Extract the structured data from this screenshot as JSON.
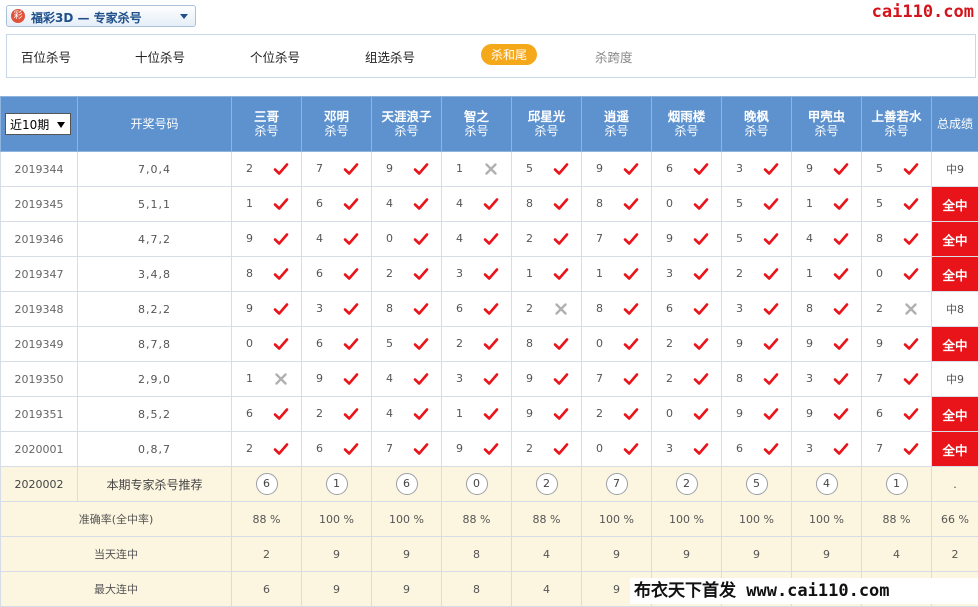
{
  "selector": {
    "icon_char": "彩",
    "label": "福彩3D — 专家杀号"
  },
  "site_logo": "cai110.com",
  "tabs": [
    {
      "label": "百位杀号",
      "state": "normal"
    },
    {
      "label": "十位杀号",
      "state": "normal"
    },
    {
      "label": "个位杀号",
      "state": "normal"
    },
    {
      "label": "组选杀号",
      "state": "normal"
    },
    {
      "label": "杀和尾",
      "state": "active"
    },
    {
      "label": "杀跨度",
      "state": "dim"
    }
  ],
  "table": {
    "period_select": "近10期",
    "draw_header": "开奖号码",
    "result_header": "总成绩",
    "sub_label": "杀号",
    "experts": [
      "三哥",
      "邓明",
      "天涯浪子",
      "智之",
      "邱星光",
      "逍遥",
      "烟雨楼",
      "晚枫",
      "甲壳虫",
      "上善若水"
    ],
    "rows": [
      {
        "issue": "2019344",
        "draw": "7,0,4",
        "kills": [
          2,
          7,
          9,
          1,
          5,
          9,
          6,
          3,
          9,
          5
        ],
        "hits": [
          1,
          1,
          1,
          0,
          1,
          1,
          1,
          1,
          1,
          1
        ],
        "result": "中9",
        "all": false
      },
      {
        "issue": "2019345",
        "draw": "5,1,1",
        "kills": [
          1,
          6,
          4,
          4,
          8,
          8,
          0,
          5,
          1,
          5
        ],
        "hits": [
          1,
          1,
          1,
          1,
          1,
          1,
          1,
          1,
          1,
          1
        ],
        "result": "全中",
        "all": true
      },
      {
        "issue": "2019346",
        "draw": "4,7,2",
        "kills": [
          9,
          4,
          0,
          4,
          2,
          7,
          9,
          5,
          4,
          8
        ],
        "hits": [
          1,
          1,
          1,
          1,
          1,
          1,
          1,
          1,
          1,
          1
        ],
        "result": "全中",
        "all": true
      },
      {
        "issue": "2019347",
        "draw": "3,4,8",
        "kills": [
          8,
          6,
          2,
          3,
          1,
          1,
          3,
          2,
          1,
          0
        ],
        "hits": [
          1,
          1,
          1,
          1,
          1,
          1,
          1,
          1,
          1,
          1
        ],
        "result": "全中",
        "all": true
      },
      {
        "issue": "2019348",
        "draw": "8,2,2",
        "kills": [
          9,
          3,
          8,
          6,
          2,
          8,
          6,
          3,
          8,
          2
        ],
        "hits": [
          1,
          1,
          1,
          1,
          0,
          1,
          1,
          1,
          1,
          0
        ],
        "result": "中8",
        "all": false
      },
      {
        "issue": "2019349",
        "draw": "8,7,8",
        "kills": [
          0,
          6,
          5,
          2,
          8,
          0,
          2,
          9,
          9,
          9
        ],
        "hits": [
          1,
          1,
          1,
          1,
          1,
          1,
          1,
          1,
          1,
          1
        ],
        "result": "全中",
        "all": true
      },
      {
        "issue": "2019350",
        "draw": "2,9,0",
        "kills": [
          1,
          9,
          4,
          3,
          9,
          7,
          2,
          8,
          3,
          7
        ],
        "hits": [
          0,
          1,
          1,
          1,
          1,
          1,
          1,
          1,
          1,
          1
        ],
        "result": "中9",
        "all": false
      },
      {
        "issue": "2019351",
        "draw": "8,5,2",
        "kills": [
          6,
          2,
          4,
          1,
          9,
          2,
          0,
          9,
          9,
          6
        ],
        "hits": [
          1,
          1,
          1,
          1,
          1,
          1,
          1,
          1,
          1,
          1
        ],
        "result": "全中",
        "all": true
      },
      {
        "issue": "2020001",
        "draw": "0,8,7",
        "kills": [
          2,
          6,
          7,
          9,
          2,
          0,
          3,
          6,
          3,
          7
        ],
        "hits": [
          1,
          1,
          1,
          1,
          1,
          1,
          1,
          1,
          1,
          1
        ],
        "result": "全中",
        "all": true
      }
    ],
    "recommend": {
      "issue": "2020002",
      "label": "本期专家杀号推荐",
      "values": [
        "6",
        "1",
        "6",
        "0",
        "2",
        "7",
        "2",
        "5",
        "4",
        "1"
      ],
      "tail": "."
    },
    "stats": [
      {
        "label": "准确率(全中率)",
        "values": [
          "88 %",
          "100 %",
          "100 %",
          "88 %",
          "88 %",
          "100 %",
          "100 %",
          "100 %",
          "100 %",
          "88 %"
        ],
        "tail": "66 %"
      },
      {
        "label": "当天连中",
        "values": [
          "2",
          "9",
          "9",
          "8",
          "4",
          "9",
          "9",
          "9",
          "9",
          "4"
        ],
        "tail": "2"
      },
      {
        "label": "最大连中",
        "values": [
          "6",
          "9",
          "9",
          "8",
          "4",
          "9",
          "",
          "",
          "",
          ""
        ],
        "tail": ""
      }
    ]
  },
  "watermark": "布衣天下首发 www.cai110.com",
  "colors": {
    "header": "#5d92cf",
    "accent": "#f6a81b",
    "hit": "#e8141a",
    "miss": "#b0b0b0",
    "stat_bg": "#fcf6e0"
  }
}
